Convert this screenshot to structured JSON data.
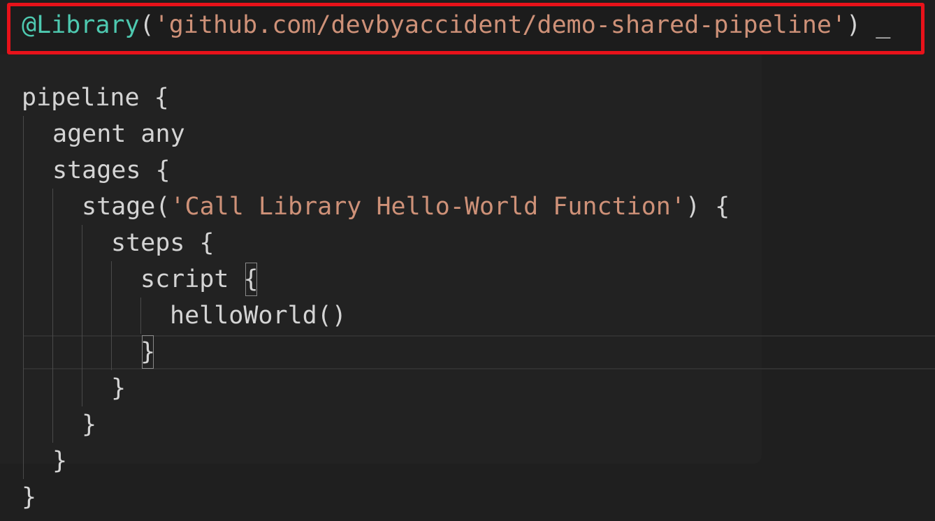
{
  "editor": {
    "annotation_line": {
      "annotation": "@Library",
      "open_paren": "(",
      "library_path": "'github.com/devbyaccident/demo-shared-pipeline'",
      "close_paren": ")",
      "cursor": "_"
    },
    "lines": {
      "l1": "pipeline {",
      "l2": "agent any",
      "l3_keyword": "stage",
      "l3_open": "(",
      "l3_string": "'Call Library Hello-World Function'",
      "l3_close": ") {",
      "l3a": "stages {",
      "l4": "steps {",
      "l5_keyword": "script ",
      "l5_bracket": "{",
      "l6": "helloWorld()",
      "l7_bracket": "}",
      "l8": "}",
      "l9": "}",
      "l10": "}",
      "l11": "}"
    },
    "colors": {
      "background": "#1f1f1f",
      "annotation": "#4ec9b0",
      "string": "#ce9178",
      "text": "#d4d4d4",
      "highlight_box": "#e8121a"
    }
  }
}
